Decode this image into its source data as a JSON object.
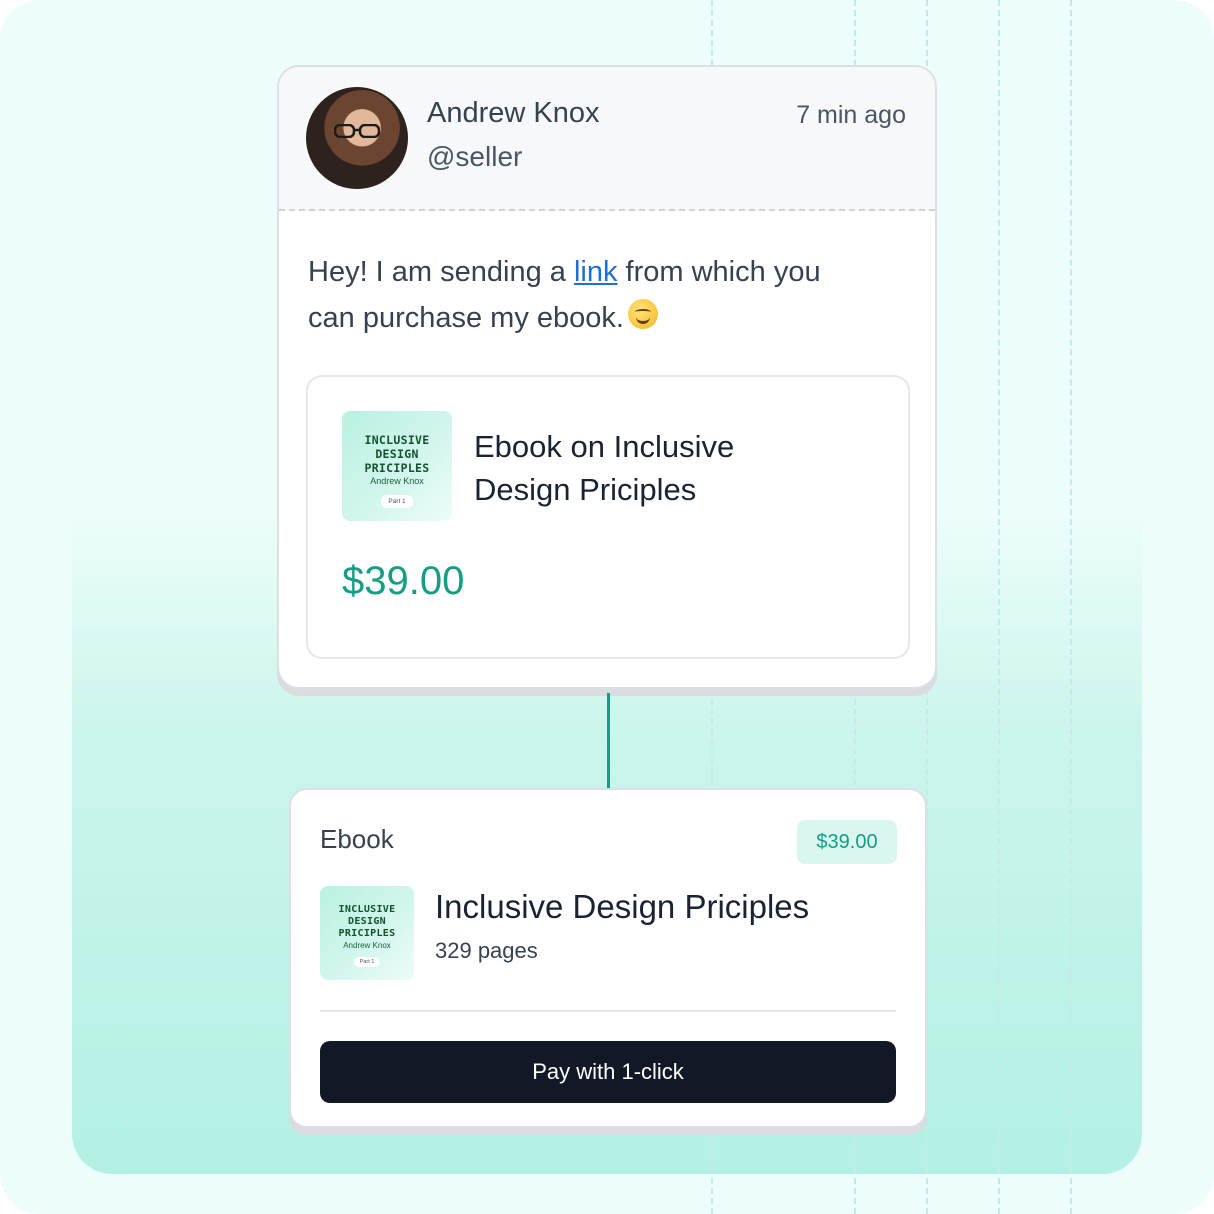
{
  "message_card": {
    "sender_name": "Andrew Knox",
    "sender_handle": "@seller",
    "timestamp": "7 min ago",
    "message_before_link": "Hey! I am sending a ",
    "link_text": "link",
    "message_after_link": " from which you can purchase my ebook.",
    "emoji": "smiling-face-emoji",
    "product": {
      "cover": {
        "title_line1": "INCLUSIVE",
        "title_line2": "DESIGN",
        "title_line3": "PRICIPLES",
        "author": "Andrew Knox",
        "part": "Part 1"
      },
      "title": "Ebook on Inclusive Design Priciples",
      "price": "$39.00"
    }
  },
  "checkout_card": {
    "type_label": "Ebook",
    "price_badge": "$39.00",
    "cover": {
      "title_line1": "INCLUSIVE",
      "title_line2": "DESIGN",
      "title_line3": "PRICIPLES",
      "author": "Andrew Knox",
      "part": "Part 1"
    },
    "title": "Inclusive Design Priciples",
    "pages": "329 pages",
    "pay_button_label": "Pay with 1-click"
  },
  "colors": {
    "accent": "#169e85",
    "link": "#1f6fd1",
    "button_bg": "#121826",
    "background": "#ecfdfb"
  }
}
